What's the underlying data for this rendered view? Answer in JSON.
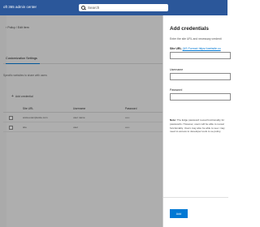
{
  "header": {
    "brand": "oft 365 admin center",
    "search_placeholder": "Search"
  },
  "page": {
    "breadcrumb": "‹  Policy  /  Edit item",
    "active_tab": "Customization Settings",
    "description": "Specific websites to share with users",
    "add_credential_label": "Add credential"
  },
  "table": {
    "headers": [
      "Site URL",
      "Username",
      "Password"
    ],
    "rows": [
      {
        "url": "www.examplesite.com",
        "username": "user name",
        "password": "•••••"
      },
      {
        "url": "site",
        "username": "user",
        "password": "•••••"
      }
    ]
  },
  "panel": {
    "title": "Add credentials",
    "subtitle": "Enter the site URL and necessary credenti",
    "site_url_label": "Site URL",
    "site_url_hint": "(US Format: https://website.co",
    "username_label": "Username",
    "password_label": "Password",
    "note_label": "Note:",
    "note_text": "The Edge password reveal functionality for passwords. However, users will be able to reveal functionality. Users may also be able to see i may need to access to developer tools to se policy.",
    "add_button": "Add"
  },
  "colors": {
    "topbar": "#2b579a",
    "accent": "#0078d4"
  }
}
